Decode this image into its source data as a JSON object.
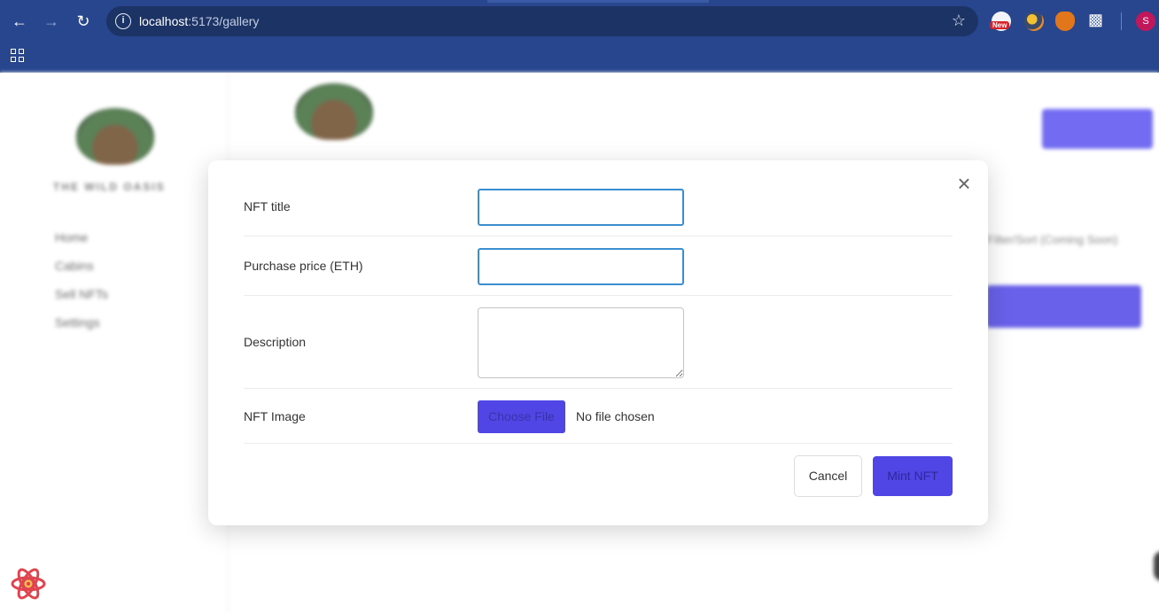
{
  "browser": {
    "url_host": "localhost",
    "url_path": ":5173/gallery",
    "extension_new_badge": "New",
    "profile_initial": "S"
  },
  "background": {
    "brand": "THE WILD OASIS",
    "nav_items": [
      "Home",
      "Cabins",
      "Sell NFTs",
      "Settings"
    ],
    "sort_text": "Filter/Sort (Coming Soon)"
  },
  "modal": {
    "fields": {
      "title_label": "NFT title",
      "title_value": "",
      "price_label": "Purchase price (ETH)",
      "price_value": "",
      "description_label": "Description",
      "description_value": "",
      "image_label": "NFT Image",
      "choose_file_label": "Choose File",
      "file_status": "No file chosen"
    },
    "cancel_label": "Cancel",
    "submit_label": "Mint NFT",
    "close_symbol": "×"
  },
  "colors": {
    "chrome": "#27468d",
    "accent": "#4f46e5",
    "input_focus": "#3b8fd1"
  },
  "icons": [
    "back-arrow-icon",
    "forward-arrow-icon",
    "reload-icon",
    "info-icon",
    "star-icon",
    "puzzle-icon",
    "apps-grid-icon",
    "close-icon",
    "react-devtools-icon"
  ]
}
